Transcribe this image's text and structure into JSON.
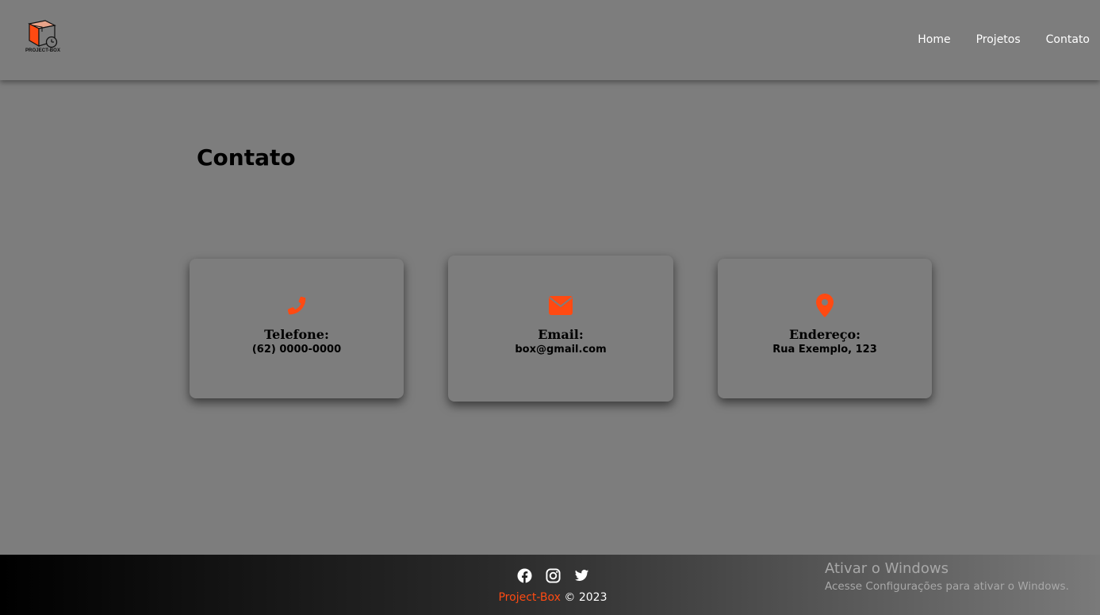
{
  "brand": {
    "logo_text": "PROJECT-BOX",
    "accent_color": "#ff4a12"
  },
  "nav": {
    "items": [
      {
        "label": "Home"
      },
      {
        "label": "Projetos"
      },
      {
        "label": "Contato"
      }
    ]
  },
  "main": {
    "title": "Contato",
    "cards": [
      {
        "icon": "phone-icon",
        "label": "Telefone:",
        "value": "(62) 0000-0000"
      },
      {
        "icon": "envelope-icon",
        "label": "Email:",
        "value": "box@gmail.com"
      },
      {
        "icon": "map-pin-icon",
        "label": "Endereço:",
        "value": "Rua Exemplo, 123"
      }
    ]
  },
  "footer": {
    "social": [
      "facebook-icon",
      "instagram-icon",
      "twitter-icon"
    ],
    "brand_name": "Project-Box",
    "copyright": "© 2023"
  },
  "windows_watermark": {
    "title": "Ativar o Windows",
    "subtitle": "Acesse Configurações para ativar o Windows."
  }
}
